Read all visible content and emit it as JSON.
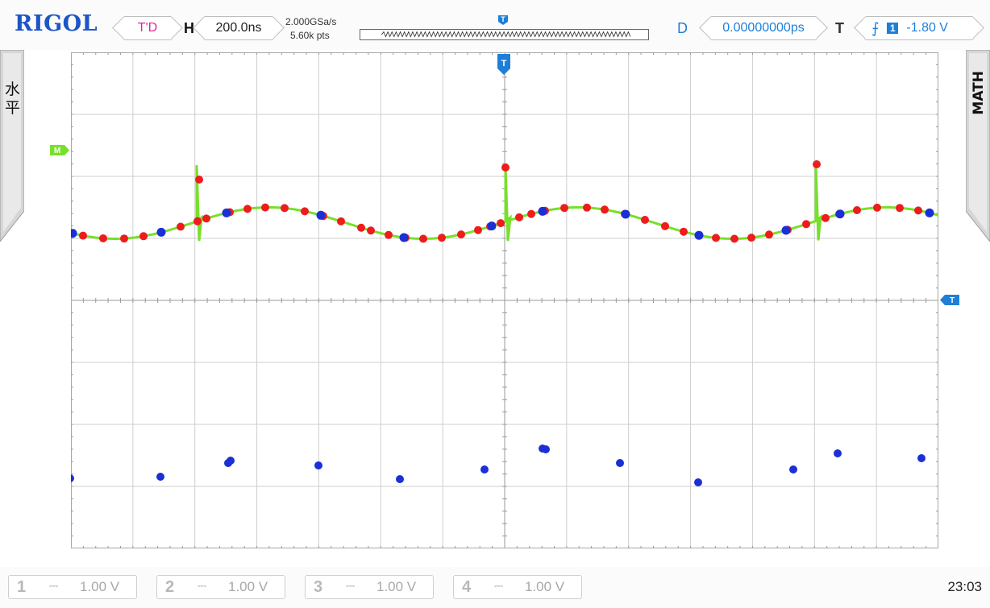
{
  "brand": "RIGOL",
  "top": {
    "mode": "T'D",
    "horizontal_label": "H",
    "timebase": "200.0ns",
    "sample_rate": "2.000GSa/s",
    "points": "5.60k pts",
    "delay_label": "D",
    "delay": "0.00000000ps",
    "trigger_label": "T",
    "trigger_source": "1",
    "trigger_level": "-1.80 V",
    "trigger_edge_icon": "rising-edge-icon"
  },
  "side": {
    "left_tab": "水平",
    "right_tab": "MATH"
  },
  "markers": {
    "math": "M",
    "trigger": "T"
  },
  "channels": [
    {
      "num": "1",
      "coupling": "⎓",
      "scale": "1.00 V"
    },
    {
      "num": "2",
      "coupling": "⎓",
      "scale": "1.00 V"
    },
    {
      "num": "3",
      "coupling": "⎓",
      "scale": "1.00 V"
    },
    {
      "num": "4",
      "coupling": "⎓",
      "scale": "1.00 V"
    }
  ],
  "clock": "23:03",
  "colors": {
    "trace": "#77e02a",
    "dot_red": "#ee1c1c",
    "dot_blue": "#1a2fd6",
    "accent_blue": "#1e7fd8",
    "brand_blue": "#1d55c8",
    "math_marker": "#77e02a"
  }
}
